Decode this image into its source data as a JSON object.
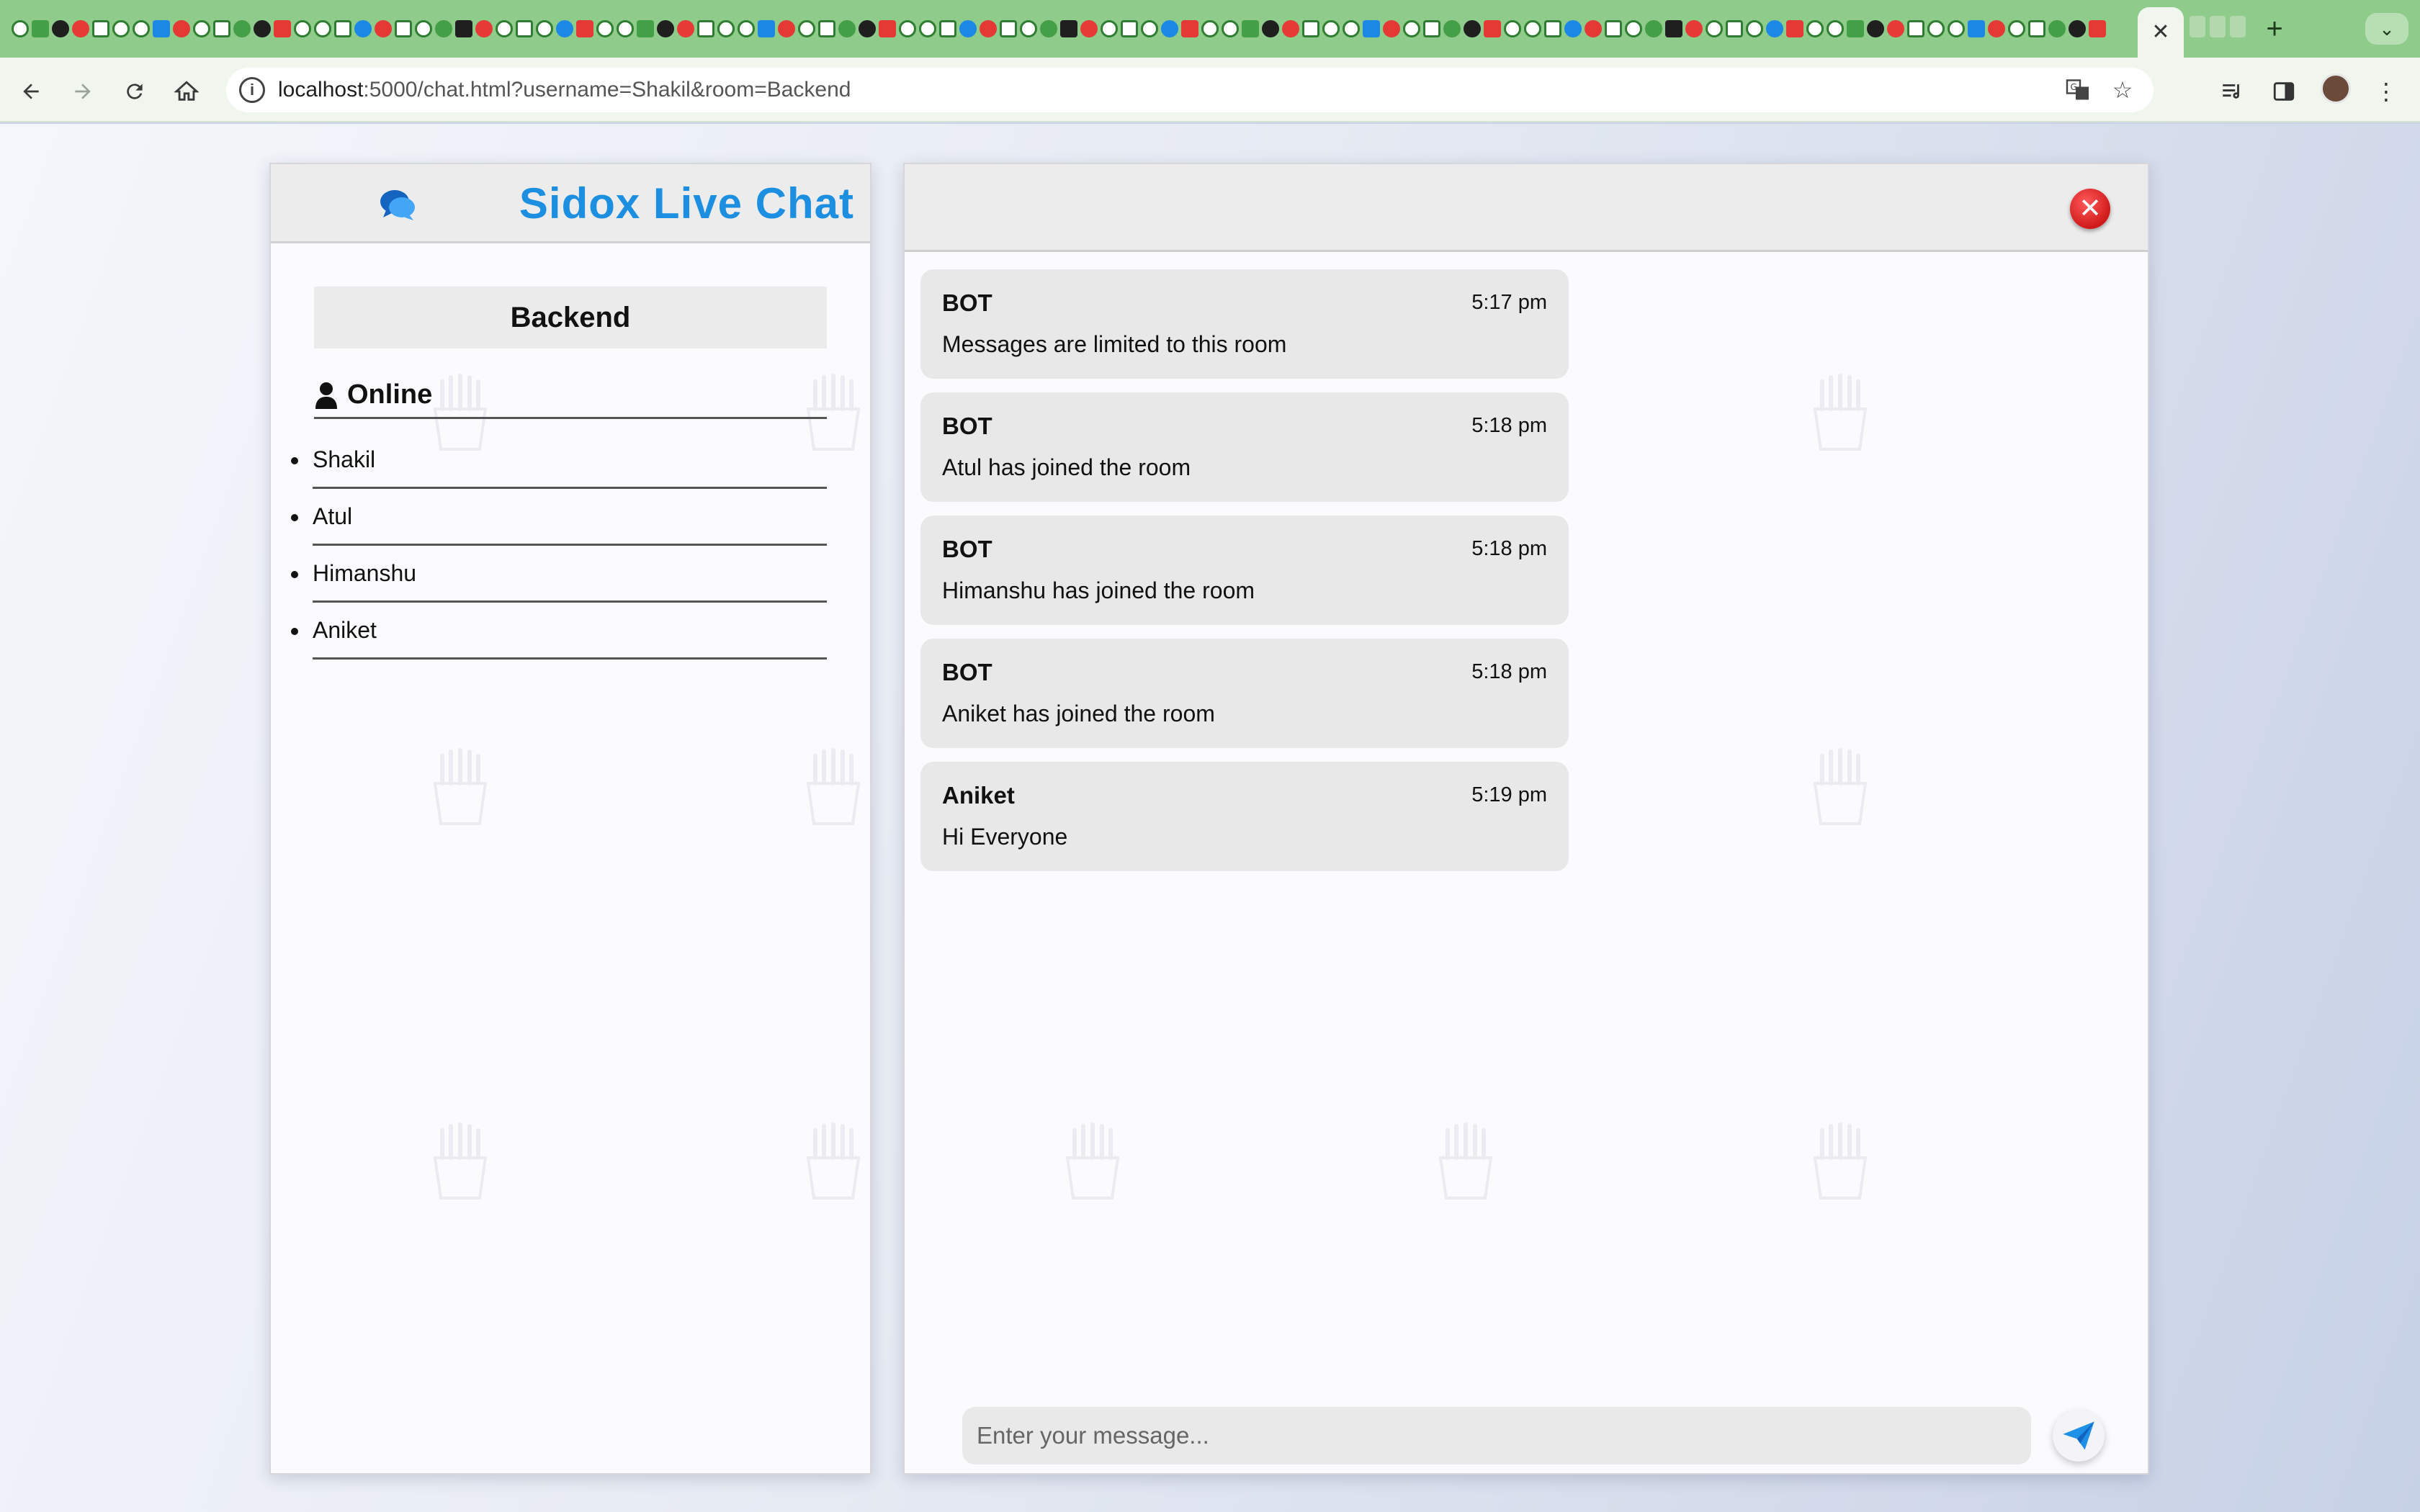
{
  "browser": {
    "url_host": "localhost",
    "url_rest": ":5000/chat.html?username=Shakil&room=Backend",
    "active_tab_close": "✕",
    "new_tab": "+",
    "tab_menu": "⌄"
  },
  "app": {
    "title": "Sidox Live Chat",
    "accent_color": "#1d8fe0"
  },
  "sidebar": {
    "room": "Backend",
    "online_label": "Online",
    "users": [
      "Shakil",
      "Atul",
      "Himanshu",
      "Aniket"
    ]
  },
  "chat": {
    "messages": [
      {
        "author": "BOT",
        "time": "5:17 pm",
        "text": "Messages are limited to this room"
      },
      {
        "author": "BOT",
        "time": "5:18 pm",
        "text": "Atul has joined the room"
      },
      {
        "author": "BOT",
        "time": "5:18 pm",
        "text": "Himanshu has joined the room"
      },
      {
        "author": "BOT",
        "time": "5:18 pm",
        "text": "Aniket has joined the room"
      },
      {
        "author": "Aniket",
        "time": "5:19 pm",
        "text": "Hi Everyone"
      }
    ],
    "input_placeholder": "Enter your message...",
    "close_symbol": "✕"
  }
}
